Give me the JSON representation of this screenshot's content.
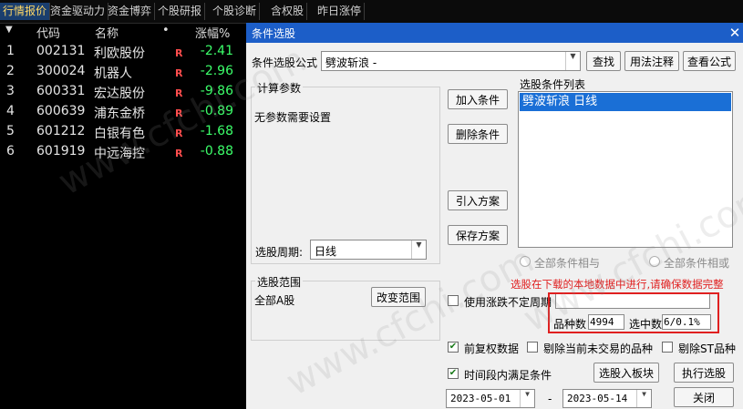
{
  "tabs": [
    "行情报价",
    "资金驱动力",
    "资金博弈",
    "个股研报",
    "个股诊断",
    "含权股",
    "昨日涨停"
  ],
  "list": {
    "headers": {
      "code": "代码",
      "name": "名称",
      "dot": "•",
      "change": "涨幅%"
    },
    "rows": [
      {
        "num": "1",
        "code": "002131",
        "name": "利欧股份",
        "flag": "R",
        "change": "-2.41"
      },
      {
        "num": "2",
        "code": "300024",
        "name": "机器人",
        "flag": "R",
        "change": "-2.96"
      },
      {
        "num": "3",
        "code": "600331",
        "name": "宏达股份",
        "flag": "R",
        "change": "-9.86"
      },
      {
        "num": "4",
        "code": "600639",
        "name": "浦东金桥",
        "flag": "R",
        "change": "-0.89"
      },
      {
        "num": "5",
        "code": "601212",
        "name": "白银有色",
        "flag": "R",
        "change": "-1.68"
      },
      {
        "num": "6",
        "code": "601919",
        "name": "中远海控",
        "flag": "R",
        "change": "-0.88"
      }
    ]
  },
  "dialog": {
    "title": "条件选股",
    "formula_label": "条件选股公式",
    "formula_value": "劈波斩浪    -",
    "btn_find": "查找",
    "btn_usage": "用法注释",
    "btn_view": "查看公式",
    "params_title": "计算参数",
    "params_text": "无参数需要设置",
    "btn_add": "加入条件",
    "btn_delete": "删除条件",
    "btn_import": "引入方案",
    "btn_save": "保存方案",
    "conditions_title": "选股条件列表",
    "conditions": [
      "劈波斩浪  日线"
    ],
    "period_label": "选股周期:",
    "period_value": "日线",
    "radio_and": "全部条件相与",
    "radio_or": "全部条件相或",
    "warning": "选股在下载的本地数据中进行,请确保数据完整",
    "range_title": "选股范围",
    "range_value": "全部A股",
    "btn_range": "改变范围",
    "chk_irregular": "使用涨跌不定周期",
    "count_label": "品种数",
    "count_value": "4994",
    "selected_label": "选中数",
    "selected_value": "6/0.1%",
    "chk_adjust": "前复权数据",
    "chk_exclude_notrade": "剔除当前未交易的品种",
    "chk_exclude_st": "剔除ST品种",
    "chk_timerange": "时间段内满足条件",
    "btn_to_block": "选股入板块",
    "btn_execute": "执行选股",
    "date_from": "2023-05-01",
    "date_sep": "-",
    "date_to": "2023-05-14",
    "btn_close": "关闭"
  },
  "watermark": "www.cfchi.com",
  "colors": {
    "title_bar": "#1c5ec8",
    "selected_row": "#1a6fd6",
    "highlight_box": "#e02020",
    "warning_text": "#e02020",
    "change_text": "#3cff6a",
    "flag_text": "#ff4d4d"
  }
}
